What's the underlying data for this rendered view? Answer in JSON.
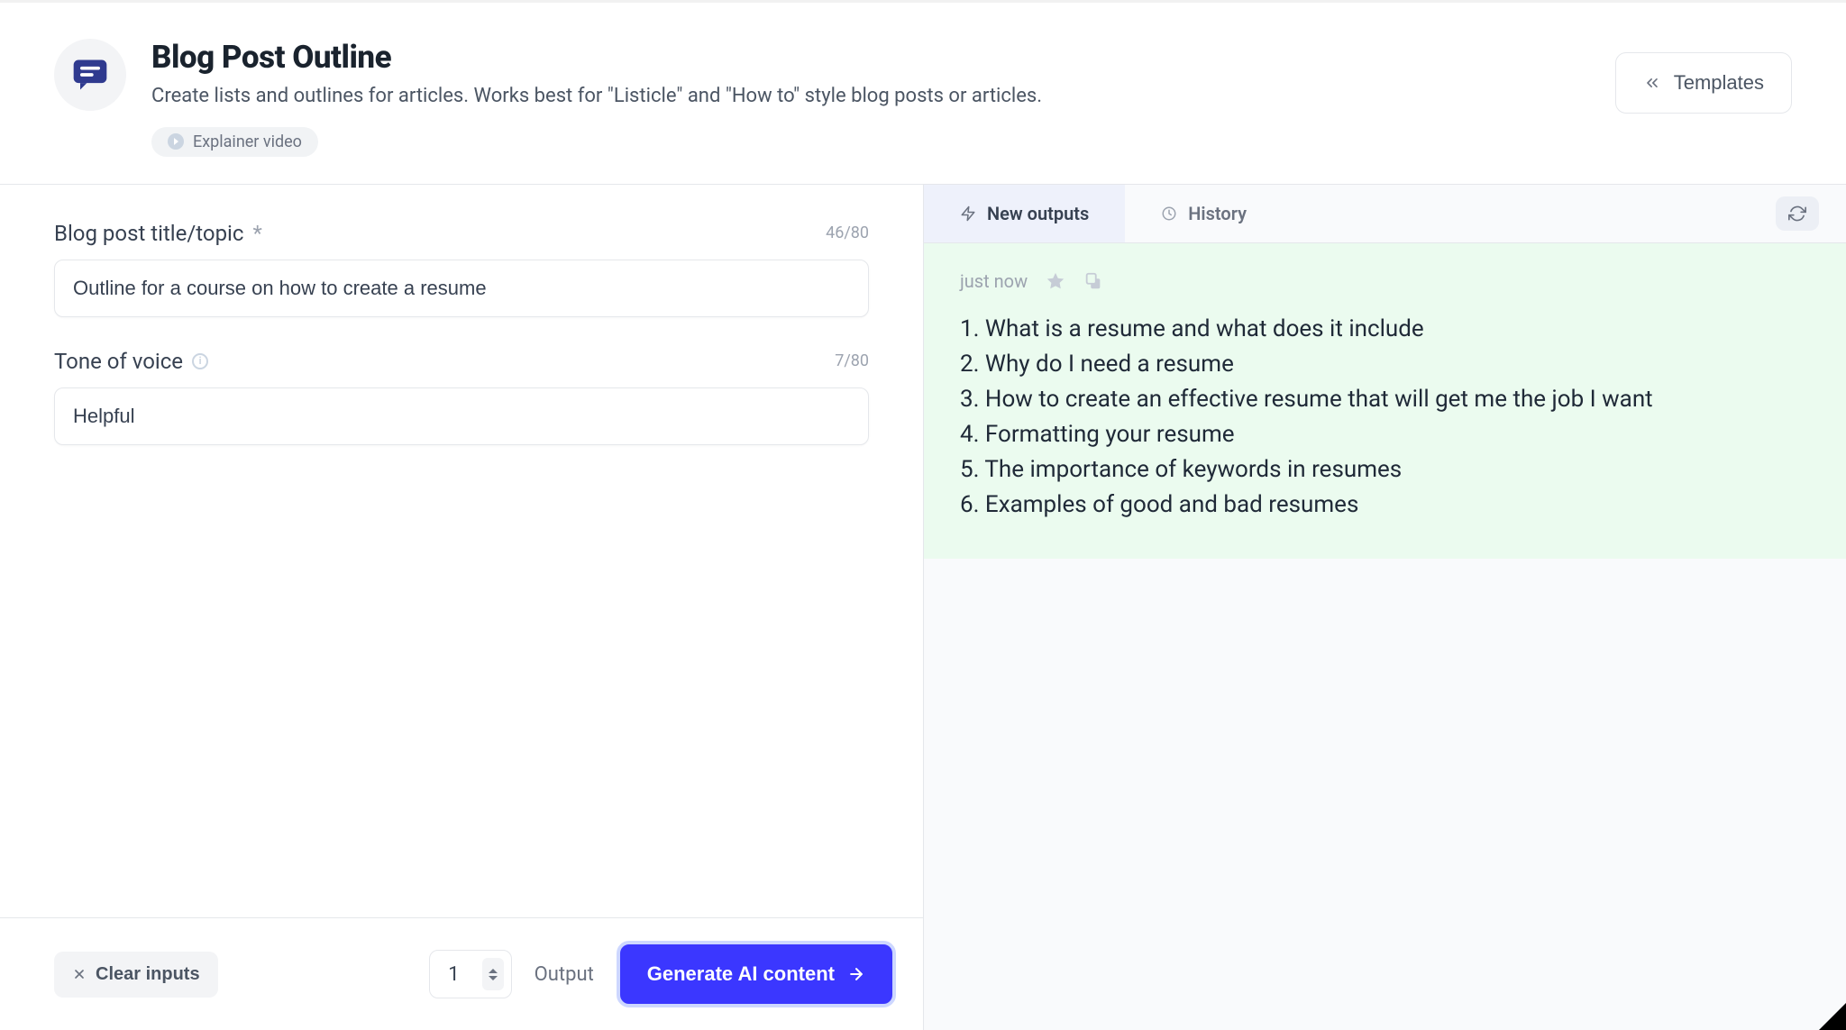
{
  "header": {
    "title": "Blog Post Outline",
    "subtitle": "Create lists and outlines for articles. Works best for \"Listicle\" and \"How to\" style blog posts or articles.",
    "explainer_label": "Explainer video",
    "templates_label": "Templates"
  },
  "form": {
    "title_field": {
      "label": "Blog post title/topic",
      "required_marker": "*",
      "counter": "46/80",
      "value": "Outline for a course on how to create a resume"
    },
    "tone_field": {
      "label": "Tone of voice",
      "counter": "7/80",
      "value": "Helpful"
    }
  },
  "footer": {
    "clear_label": "Clear inputs",
    "output_count": "1",
    "output_label": "Output",
    "generate_label": "Generate AI content"
  },
  "right": {
    "tabs": {
      "new_outputs": "New outputs",
      "history": "History"
    },
    "card": {
      "timestamp": "just now",
      "items": [
        "1. What is a resume and what does it include",
        "2. Why do I need a resume",
        "3. How to create an effective resume that will get me the job I want",
        "4. Formatting your resume",
        "5. The importance of keywords in resumes",
        "6. Examples of good and bad resumes"
      ]
    }
  }
}
